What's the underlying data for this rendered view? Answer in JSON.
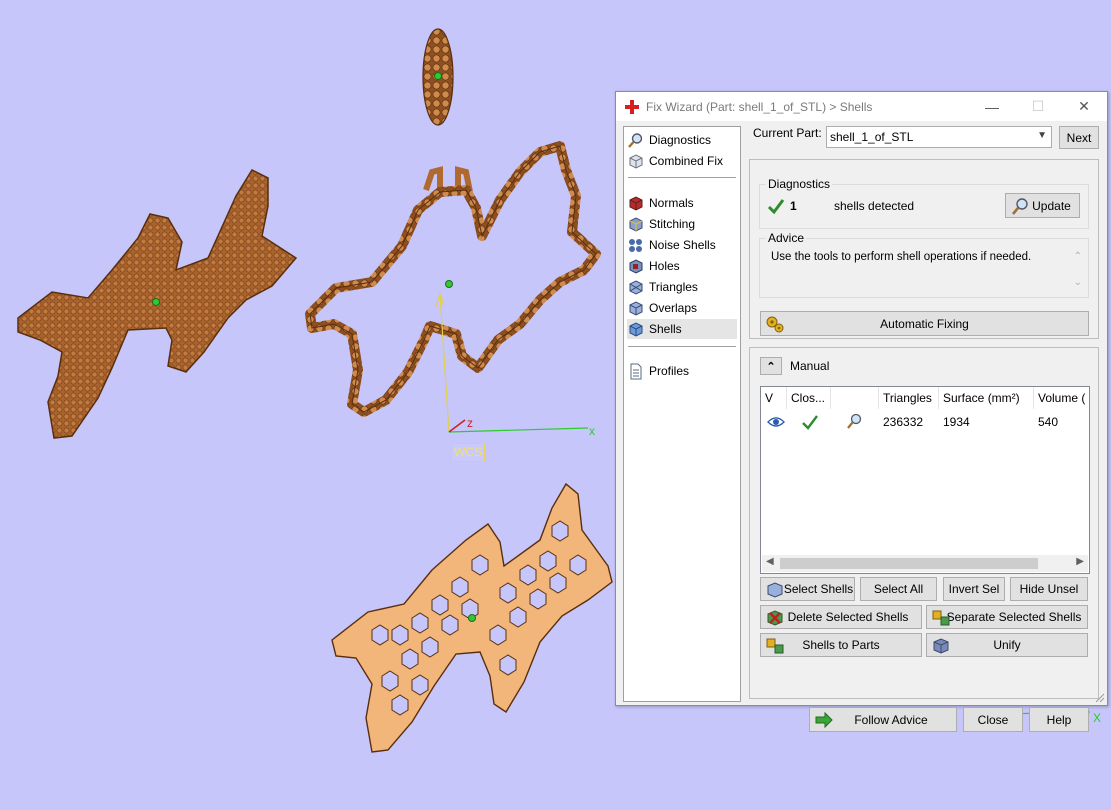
{
  "viewport": {
    "wcs_label": "WCS",
    "axis_x": "x",
    "axis_z": "z",
    "mini_axis_x": "X",
    "mini_axis_z": "Z",
    "background": "#c6c6fb"
  },
  "dialog": {
    "title": "Fix Wizard (Part: shell_1_of_STL) > Shells",
    "window_buttons": {
      "minimize": "—",
      "maximize": "☐",
      "close": "✕"
    },
    "nav": {
      "top_items": [
        {
          "label": "Diagnostics",
          "icon": "magnifier-icon"
        },
        {
          "label": "Combined Fix",
          "icon": "cube-icon"
        }
      ],
      "fix_items": [
        {
          "label": "Normals",
          "icon": "normals-cube-icon"
        },
        {
          "label": "Stitching",
          "icon": "stitching-cube-icon"
        },
        {
          "label": "Noise Shells",
          "icon": "noise-shells-icon"
        },
        {
          "label": "Holes",
          "icon": "holes-cube-icon"
        },
        {
          "label": "Triangles",
          "icon": "triangles-cube-icon"
        },
        {
          "label": "Overlaps",
          "icon": "overlaps-cube-icon"
        },
        {
          "label": "Shells",
          "icon": "shells-cube-icon",
          "selected": true
        }
      ],
      "bottom_items": [
        {
          "label": "Profiles",
          "icon": "profiles-document-icon"
        }
      ]
    },
    "current_part_label": "Current Part:",
    "current_part_value": "shell_1_of_STL",
    "next_button": "Next",
    "diagnostics": {
      "legend": "Diagnostics",
      "count": "1",
      "text": "shells detected",
      "update_button": "Update"
    },
    "advice": {
      "legend": "Advice",
      "text": "Use the tools to perform shell operations if needed."
    },
    "automatic_fixing_button": "Automatic Fixing",
    "manual_label": "Manual",
    "table": {
      "columns": [
        "V",
        "Clos...",
        "",
        "Triangles",
        "Surface (mm²)",
        "Volume ("
      ],
      "rows": [
        {
          "visible_icon": "eye-icon",
          "closed_icon": "checkmark-icon",
          "tool_icon": "magnifier-icon",
          "triangles": "236332",
          "surface": "1934",
          "volume": "540"
        }
      ]
    },
    "buttons": {
      "select_shells": "Select Shells",
      "select_all": "Select All",
      "invert_sel": "Invert Sel",
      "hide_unsel": "Hide Unsel",
      "delete_selected_shells": "Delete Selected Shells",
      "separate_selected_shells": "Separate Selected Shells",
      "shells_to_parts": "Shells to Parts",
      "unify": "Unify",
      "follow_advice": "Follow Advice",
      "close": "Close",
      "help": "Help"
    },
    "colors": {
      "check_green": "#2e8b2e",
      "accent_blue": "#2a5db0",
      "follow_arrow_green": "#3aa53a"
    }
  }
}
